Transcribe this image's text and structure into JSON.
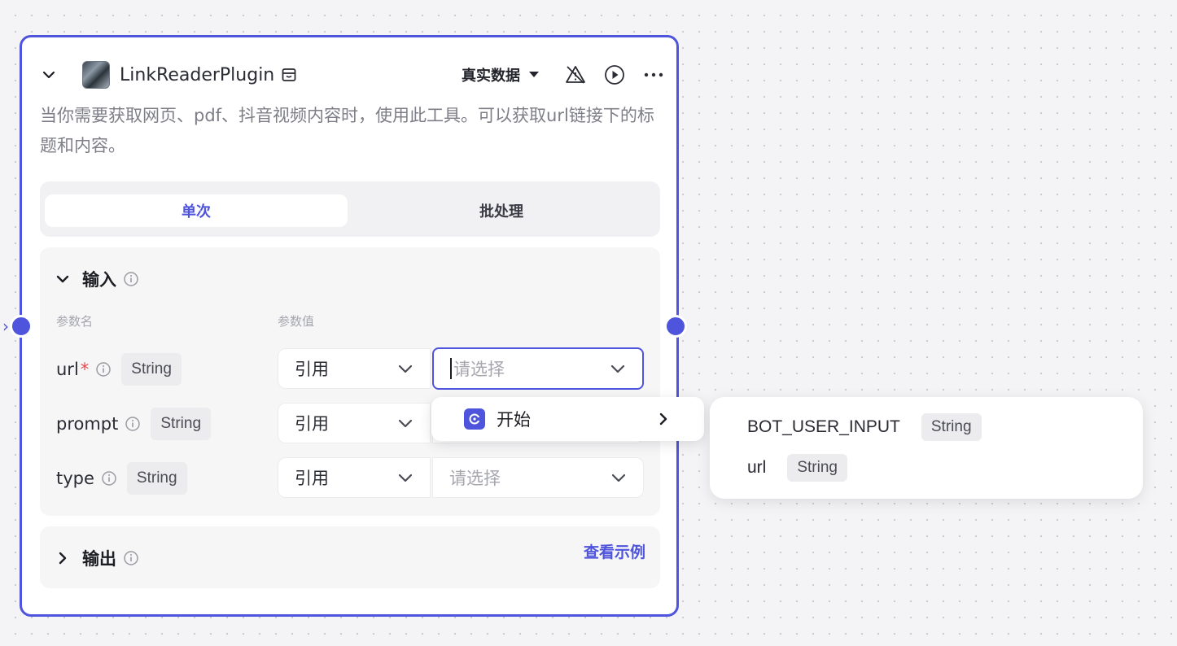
{
  "node": {
    "title": "LinkReaderPlugin",
    "data_source": "真实数据",
    "description": "当你需要获取网页、pdf、抖音视频内容时，使用此工具。可以获取url链接下的标题和内容。",
    "mode_tabs": [
      {
        "label": "单次",
        "active": true
      },
      {
        "label": "批处理",
        "active": false
      }
    ],
    "input": {
      "title": "输入",
      "col_name": "参数名",
      "col_value": "参数值",
      "rows": [
        {
          "name": "url",
          "required": "*",
          "type": "String",
          "ref": "引用",
          "placeholder": "请选择"
        },
        {
          "name": "prompt",
          "required": "",
          "type": "String",
          "ref": "引用",
          "placeholder": ""
        },
        {
          "name": "type",
          "required": "",
          "type": "String",
          "ref": "引用",
          "placeholder": "请选择"
        }
      ]
    },
    "output": {
      "title": "输出",
      "see_example": "查看示例"
    }
  },
  "dropdown": {
    "group_label": "开始",
    "variables": [
      {
        "name": "BOT_USER_INPUT",
        "type": "String"
      },
      {
        "name": "url",
        "type": "String"
      }
    ]
  },
  "colors": {
    "accent": "#4e54db",
    "required": "#e5484d"
  }
}
